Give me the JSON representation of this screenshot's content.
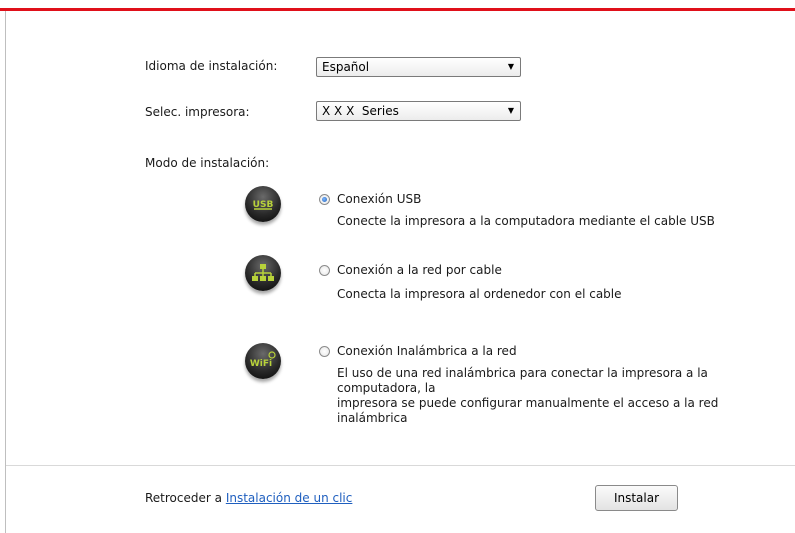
{
  "form": {
    "language_label": "Idioma de instalación:",
    "language_value": "Español",
    "printer_label": "Selec. impresora:",
    "printer_value": "X X X  Series",
    "mode_label": "Modo de instalación:"
  },
  "options": [
    {
      "title": "Conexión USB",
      "description": "Conecte la impresora a la computadora mediante el cable USB",
      "icon": "usb-icon",
      "selected": true
    },
    {
      "title": "Conexión a la red por cable",
      "description": "Conecta la impresora al ordenedor con el cable",
      "icon": "wired-network-icon",
      "selected": false
    },
    {
      "title": "Conexión Inalámbrica a la red",
      "description_line1": "El uso de una red inalámbrica para conectar la impresora a la computadora, la",
      "description_line2": "impresora se puede configurar manualmente el acceso a la red inalámbrica",
      "icon": "wifi-icon",
      "selected": false
    }
  ],
  "icons": {
    "usb_text": "USB",
    "wifi_text": "WiFi"
  },
  "footer": {
    "back_text": "Retroceder a",
    "back_link": "Instalación de un clic",
    "install_button": "Instalar"
  },
  "colors": {
    "accent_bar": "#e0101a",
    "link": "#1f5fbf",
    "radio_selected": "#1d5fb8"
  }
}
